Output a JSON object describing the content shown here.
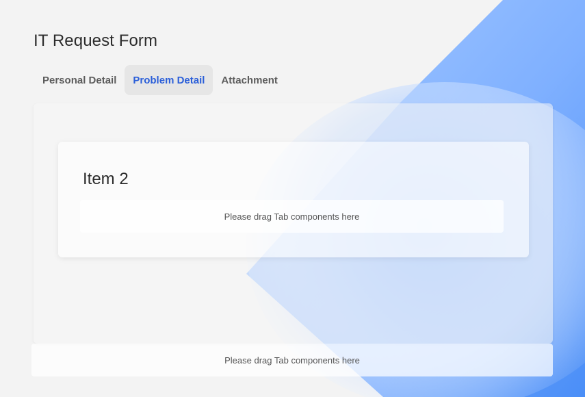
{
  "form": {
    "title": "IT Request Form"
  },
  "tabs": [
    {
      "label": "Personal Detail",
      "active": false
    },
    {
      "label": "Problem Detail",
      "active": true
    },
    {
      "label": "Attachment",
      "active": false
    }
  ],
  "card": {
    "title": "Item 2",
    "dropzone_text": "Please drag Tab components here"
  },
  "footer": {
    "dropzone_text": "Please drag Tab components here"
  },
  "colors": {
    "accent": "#2b5fd9",
    "background": "#f3f3f3",
    "gradient_light": "#cfe2ff",
    "gradient_dark": "#4a90ff"
  }
}
